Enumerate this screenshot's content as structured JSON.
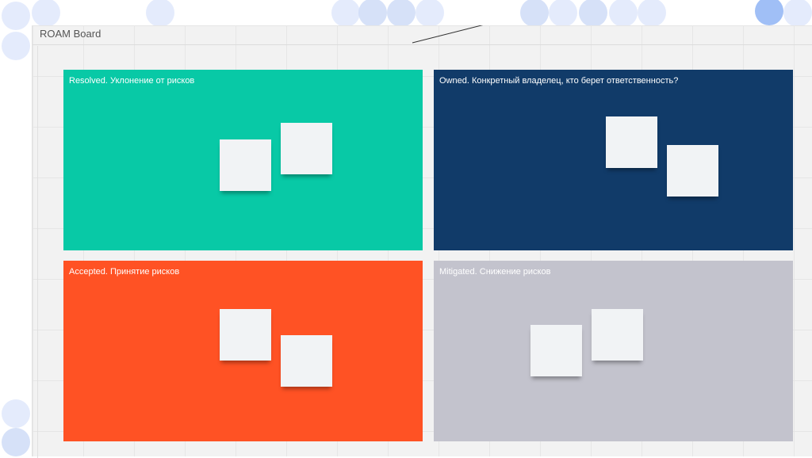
{
  "board": {
    "title": "ROAM Board"
  },
  "quadrants": [
    {
      "title": "Resolved. Уклонение от рисков",
      "color": "#08c9a6",
      "sticky_notes": 2
    },
    {
      "title": "Owned. Конкретный владелец, кто берет ответственность?",
      "color": "#113b69",
      "sticky_notes": 2
    },
    {
      "title": "Accepted. Принятие рисков",
      "color": "#ff5224",
      "sticky_notes": 2
    },
    {
      "title": "Mitigated. Снижение рисков",
      "color": "#c3c3cd",
      "sticky_notes": 2
    }
  ],
  "colors": {
    "sticky_note": "#f1f3f5",
    "board_background": "#f2f2f2",
    "avatar_dot": "#dfe8fb"
  }
}
